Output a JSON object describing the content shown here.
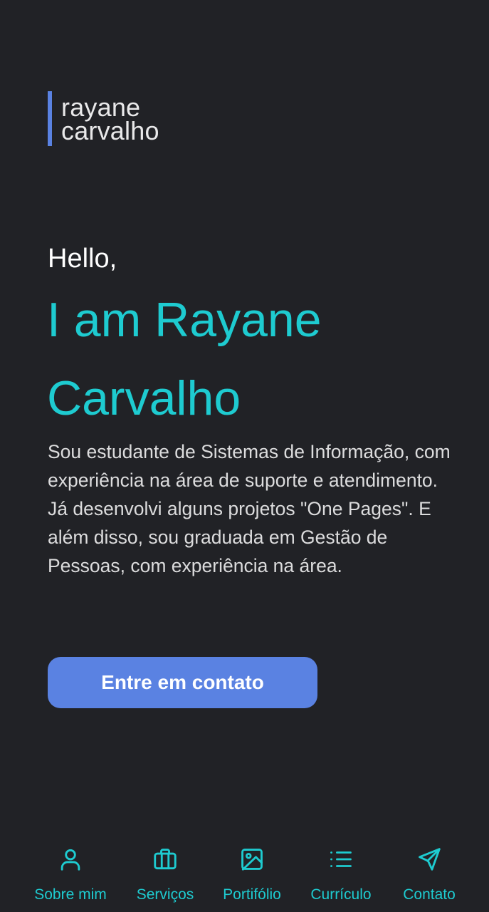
{
  "logo": {
    "line1": "rayane",
    "line2": "carvalho"
  },
  "hero": {
    "greeting": "Hello,",
    "headline_line1": "I am Rayane",
    "headline_line2": "Carvalho",
    "bio": "Sou estudante de Sistemas de Informação, com experiência na área de suporte e atendimento. Já desenvolvi alguns projetos \"One Pages\". E além disso, sou graduada em Gestão de Pessoas, com experiência na área.",
    "cta_label": "Entre em contato"
  },
  "nav": {
    "items": [
      {
        "label": "Sobre mim",
        "icon": "user-icon"
      },
      {
        "label": "Serviços",
        "icon": "briefcase-icon"
      },
      {
        "label": "Portifólio",
        "icon": "image-icon"
      },
      {
        "label": "Currículo",
        "icon": "list-icon"
      },
      {
        "label": "Contato",
        "icon": "send-icon"
      }
    ]
  },
  "colors": {
    "background": "#212226",
    "accent": "#1ecbd0",
    "button": "#5a82e2",
    "text": "#dcdcdd"
  }
}
